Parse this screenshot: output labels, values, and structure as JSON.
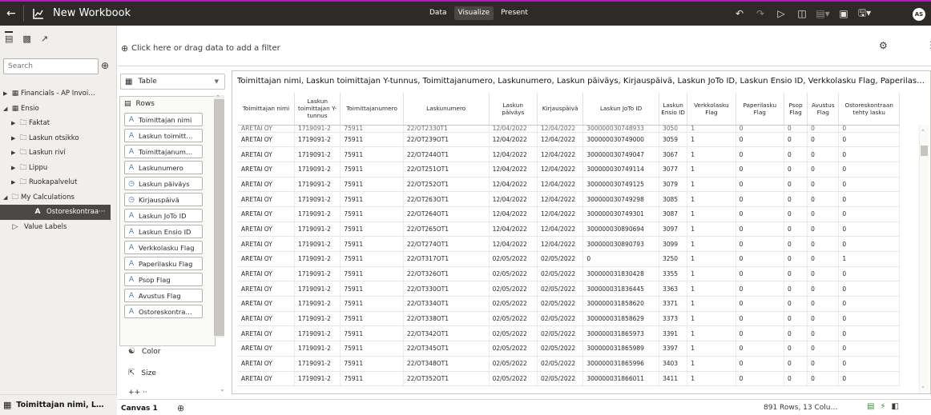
{
  "app": {
    "title": "New Workbook",
    "avatar_initials": "AS",
    "tabs": [
      {
        "label": "Data",
        "active": false
      },
      {
        "label": "Visualize",
        "active": true
      },
      {
        "label": "Present",
        "active": false
      }
    ],
    "colors": {
      "accent": "#b21dad",
      "topbar": "#2d2b29",
      "panel": "#f1efed"
    }
  },
  "data_panel": {
    "search_placeholder": "Search",
    "tree": [
      {
        "label": "Financials - AP Invoi…",
        "level": 0,
        "icon": "subject-area-icon",
        "expanded": false
      },
      {
        "label": "Ensio",
        "level": 0,
        "icon": "subject-area-icon",
        "expanded": true
      },
      {
        "label": "Faktat",
        "level": 1,
        "icon": "folder-icon",
        "expanded": false
      },
      {
        "label": "Laskun otsikko",
        "level": 1,
        "icon": "folder-icon",
        "expanded": false
      },
      {
        "label": "Laskun rivi",
        "level": 1,
        "icon": "folder-icon",
        "expanded": false
      },
      {
        "label": "Lippu",
        "level": 1,
        "icon": "folder-icon",
        "expanded": false
      },
      {
        "label": "Ruokapalvelut",
        "level": 1,
        "icon": "folder-icon",
        "expanded": false
      },
      {
        "label": "My Calculations",
        "level": 0,
        "icon": "folder-icon",
        "expanded": true
      },
      {
        "label": "Ostoreskontraa···",
        "level": 1,
        "icon": "attribute-icon",
        "selected": true
      },
      {
        "label": "Value Labels",
        "level": 0,
        "icon": "tag-icon"
      }
    ],
    "footer_label": "Toimittajan nimi, L…"
  },
  "filter_bar": {
    "placeholder": "Click here or drag data to add a filter"
  },
  "grammar": {
    "viz_type": "Table",
    "rows_label": "Rows",
    "pills": [
      {
        "icon": "attribute-icon",
        "label": "Toimittajan nimi"
      },
      {
        "icon": "attribute-icon",
        "label": "Laskun toimitt…"
      },
      {
        "icon": "attribute-icon",
        "label": "Toimittajanum…"
      },
      {
        "icon": "attribute-icon",
        "label": "Laskunumero"
      },
      {
        "icon": "date-icon",
        "label": "Laskun päiväys"
      },
      {
        "icon": "date-icon",
        "label": "Kirjauspäivä"
      },
      {
        "icon": "attribute-icon",
        "label": "Laskun JoTo ID"
      },
      {
        "icon": "attribute-icon",
        "label": "Laskun Ensio ID"
      },
      {
        "icon": "attribute-icon",
        "label": "Verkkolasku Flag"
      },
      {
        "icon": "attribute-icon",
        "label": "Paperilasku Flag"
      },
      {
        "icon": "attribute-icon",
        "label": "Psop Flag"
      },
      {
        "icon": "attribute-icon",
        "label": "Avustus Flag"
      },
      {
        "icon": "attribute-icon",
        "label": "Ostoreskontra…"
      }
    ],
    "color_label": "Color",
    "size_label": "Size",
    "shape_label_partial": "++ ··"
  },
  "viz": {
    "title": "Toimittajan nimi, Laskun toimittajan Y-tunnus, Toimittajanumero, Laskunumero, Laskun päiväys, Kirjauspäivä, Laskun JoTo ID, Laskun Ensio ID, Verkkolasku Flag, Paperilasku Flag, P…",
    "columns": [
      "Toimittajan nimi",
      "Laskun toimittajan Y-tunnus",
      "Toimittajanumero",
      "Laskunumero",
      "Laskun päiväys",
      "Kirjauspäivä",
      "Laskun JoTo ID",
      "Laskun Ensio ID",
      "Verkkolasku Flag",
      "Paperilasku Flag",
      "Psop Flag",
      "Avustus Flag",
      "Ostoreskontraan tehty lasku"
    ],
    "cut_row": [
      "ARETAI OY",
      "1719091-2",
      "75911",
      "22/OT2330T1",
      "12/04/2022",
      "12/04/2022",
      "300000030748933",
      "3050",
      "1",
      "0",
      "0",
      "0",
      "0"
    ],
    "rows": [
      [
        "ARETAI OY",
        "1719091-2",
        "75911",
        "22/OT239OT1",
        "12/04/2022",
        "12/04/2022",
        "300000030749000",
        "3059",
        "1",
        "0",
        "0",
        "0",
        "0"
      ],
      [
        "ARETAI OY",
        "1719091-2",
        "75911",
        "22/OT244OT1",
        "12/04/2022",
        "12/04/2022",
        "300000030749047",
        "3067",
        "1",
        "0",
        "0",
        "0",
        "0"
      ],
      [
        "ARETAI OY",
        "1719091-2",
        "75911",
        "22/OT251OT1",
        "12/04/2022",
        "12/04/2022",
        "300000030749114",
        "3077",
        "1",
        "0",
        "0",
        "0",
        "0"
      ],
      [
        "ARETAI OY",
        "1719091-2",
        "75911",
        "22/OT252OT1",
        "12/04/2022",
        "12/04/2022",
        "300000030749125",
        "3079",
        "1",
        "0",
        "0",
        "0",
        "0"
      ],
      [
        "ARETAI OY",
        "1719091-2",
        "75911",
        "22/OT263OT1",
        "12/04/2022",
        "12/04/2022",
        "300000030749298",
        "3085",
        "1",
        "0",
        "0",
        "0",
        "0"
      ],
      [
        "ARETAI OY",
        "1719091-2",
        "75911",
        "22/OT264OT1",
        "12/04/2022",
        "12/04/2022",
        "300000030749301",
        "3087",
        "1",
        "0",
        "0",
        "0",
        "0"
      ],
      [
        "ARETAI OY",
        "1719091-2",
        "75911",
        "22/OT265OT1",
        "12/04/2022",
        "12/04/2022",
        "300000030890694",
        "3097",
        "1",
        "0",
        "0",
        "0",
        "0"
      ],
      [
        "ARETAI OY",
        "1719091-2",
        "75911",
        "22/OT274OT1",
        "12/04/2022",
        "12/04/2022",
        "300000030890793",
        "3099",
        "1",
        "0",
        "0",
        "0",
        "0"
      ],
      [
        "ARETAI OY",
        "1719091-2",
        "75911",
        "22/OT317OT1",
        "02/05/2022",
        "02/05/2022",
        "0",
        "3250",
        "1",
        "0",
        "0",
        "0",
        "1"
      ],
      [
        "ARETAI OY",
        "1719091-2",
        "75911",
        "22/OT326OT1",
        "02/05/2022",
        "02/05/2022",
        "300000031830428",
        "3355",
        "1",
        "0",
        "0",
        "0",
        "0"
      ],
      [
        "ARETAI OY",
        "1719091-2",
        "75911",
        "22/OT330OT1",
        "02/05/2022",
        "02/05/2022",
        "300000031836445",
        "3363",
        "1",
        "0",
        "0",
        "0",
        "0"
      ],
      [
        "ARETAI OY",
        "1719091-2",
        "75911",
        "22/OT334OT1",
        "02/05/2022",
        "02/05/2022",
        "300000031858620",
        "3371",
        "1",
        "0",
        "0",
        "0",
        "0"
      ],
      [
        "ARETAI OY",
        "1719091-2",
        "75911",
        "22/OT338OT1",
        "02/05/2022",
        "02/05/2022",
        "300000031858629",
        "3373",
        "1",
        "0",
        "0",
        "0",
        "0"
      ],
      [
        "ARETAI OY",
        "1719091-2",
        "75911",
        "22/OT342OT1",
        "02/05/2022",
        "02/05/2022",
        "300000031865973",
        "3391",
        "1",
        "0",
        "0",
        "0",
        "0"
      ],
      [
        "ARETAI OY",
        "1719091-2",
        "75911",
        "22/OT345OT1",
        "02/05/2022",
        "02/05/2022",
        "300000031865989",
        "3397",
        "1",
        "0",
        "0",
        "0",
        "0"
      ],
      [
        "ARETAI OY",
        "1719091-2",
        "75911",
        "22/OT348OT1",
        "02/05/2022",
        "02/05/2022",
        "300000031865996",
        "3403",
        "1",
        "0",
        "0",
        "0",
        "0"
      ],
      [
        "ARETAI OY",
        "1719091-2",
        "75911",
        "22/OT352OT1",
        "02/05/2022",
        "02/05/2022",
        "300000031866011",
        "3411",
        "1",
        "0",
        "0",
        "0",
        "0"
      ]
    ]
  },
  "bottom_bar": {
    "canvas_tab": "Canvas 1",
    "status": "891 Rows, 13 Colu…"
  }
}
